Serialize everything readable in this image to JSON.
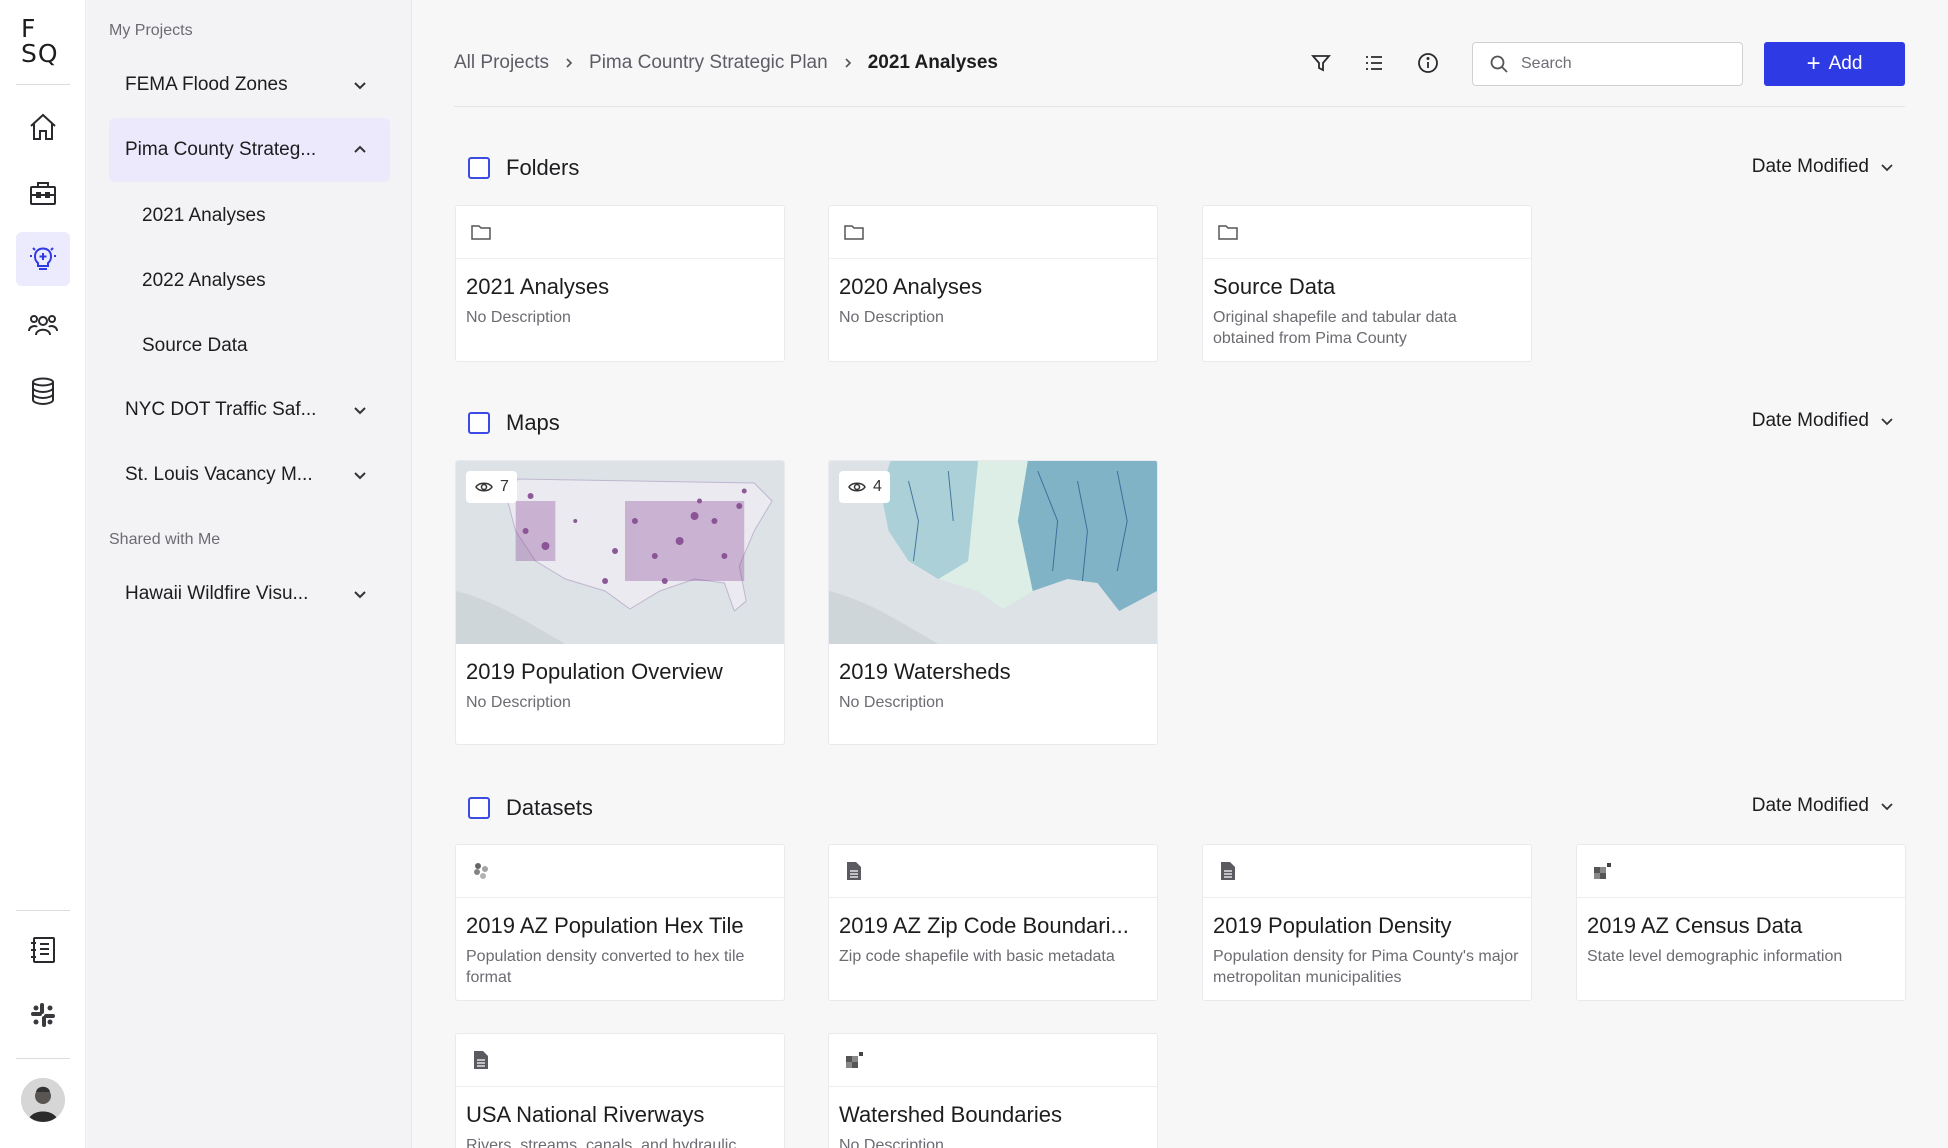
{
  "app": {
    "logo": "F SQ"
  },
  "rail": {
    "items": [
      "home-icon",
      "briefcase-icon",
      "lightbulb-icon",
      "team-icon",
      "database-icon"
    ],
    "bottom": [
      "notebook-icon",
      "slack-icon"
    ],
    "active": "lightbulb-icon",
    "accent": "#2e3ae3"
  },
  "sidebar": {
    "my_projects_label": "My Projects",
    "shared_label": "Shared with Me",
    "projects": [
      {
        "label": "FEMA Flood Zones",
        "expanded": false
      },
      {
        "label": "Pima County Strateg...",
        "expanded": true,
        "children": [
          "2021 Analyses",
          "2022 Analyses",
          "Source Data"
        ]
      },
      {
        "label": "NYC DOT Traffic Saf...",
        "expanded": false
      },
      {
        "label": "St. Louis Vacancy M...",
        "expanded": false
      }
    ],
    "shared": [
      {
        "label": "Hawaii Wildfire Visu...",
        "expanded": false
      }
    ]
  },
  "header": {
    "breadcrumb": [
      "All Projects",
      "Pima Country Strategic Plan",
      "2021 Analyses"
    ],
    "search_placeholder": "Search",
    "add_label": "Add"
  },
  "sections": {
    "folders": {
      "title": "Folders",
      "sort": "Date Modified",
      "items": [
        {
          "title": "2021 Analyses",
          "desc": "No Description"
        },
        {
          "title": "2020 Analyses",
          "desc": "No Description"
        },
        {
          "title": "Source Data",
          "desc": "Original shapefile and tabular data obtained from Pima County"
        }
      ]
    },
    "maps": {
      "title": "Maps",
      "sort": "Date Modified",
      "items": [
        {
          "title": "2019 Population Overview",
          "desc": "No Description",
          "views": "7"
        },
        {
          "title": "2019 Watersheds",
          "desc": "No Description",
          "views": "4"
        }
      ]
    },
    "datasets": {
      "title": "Datasets",
      "sort": "Date Modified",
      "items": [
        {
          "title": "2019 AZ Population Hex Tile",
          "desc": "Population density converted to hex tile format",
          "icon": "hex-tile-icon"
        },
        {
          "title": "2019 AZ Zip Code Boundari...",
          "desc": "Zip code shapefile with basic metadata",
          "icon": "file-icon"
        },
        {
          "title": "2019 Population Density",
          "desc": "Population density for Pima County's major metropolitan municipalities",
          "icon": "file-icon"
        },
        {
          "title": "2019 AZ Census Data",
          "desc": "State level demographic information",
          "icon": "tileset-icon"
        },
        {
          "title": "USA National Riverways",
          "desc": "Rivers, streams, canals, and hydraulic",
          "icon": "file-icon"
        },
        {
          "title": "Watershed Boundaries",
          "desc": "No Description",
          "icon": "tileset-icon"
        }
      ]
    }
  }
}
